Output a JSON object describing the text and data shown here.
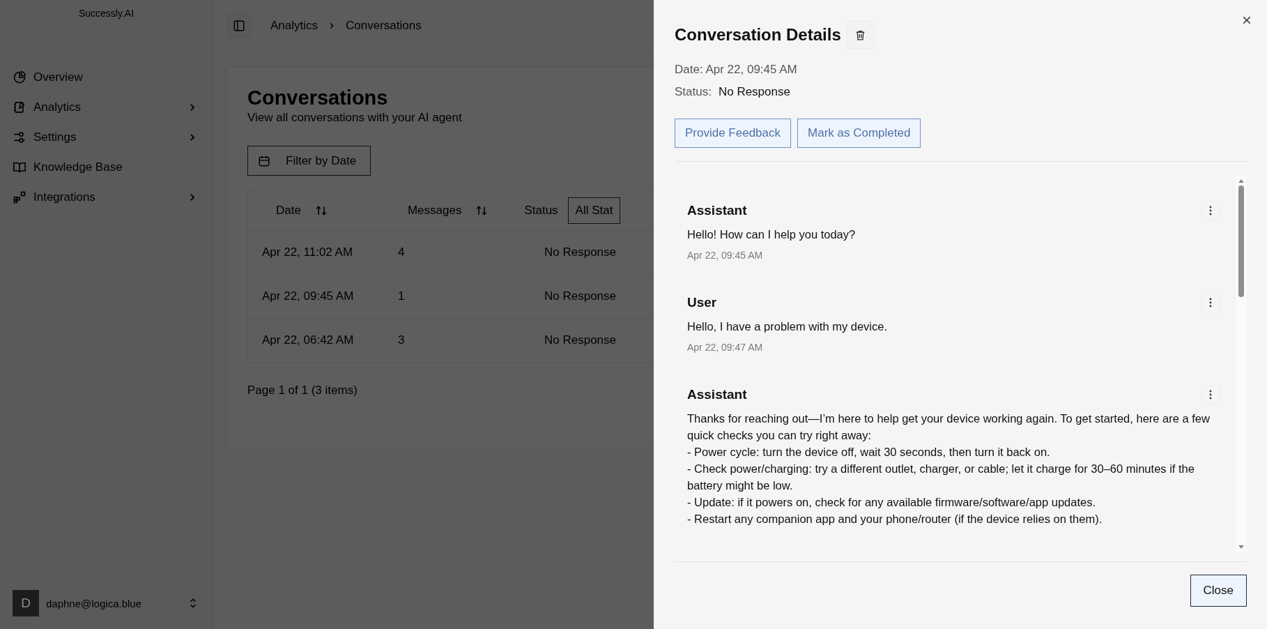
{
  "sidebar": {
    "logo": "Successly.AI",
    "items": [
      {
        "label": "Overview",
        "has_submenu": false
      },
      {
        "label": "Analytics",
        "has_submenu": true
      },
      {
        "label": "Settings",
        "has_submenu": true
      },
      {
        "label": "Knowledge Base",
        "has_submenu": false
      },
      {
        "label": "Integrations",
        "has_submenu": true
      }
    ],
    "user": {
      "initial": "D",
      "email": "daphne@logica.blue"
    }
  },
  "breadcrumb": [
    "Analytics",
    "Conversations"
  ],
  "page": {
    "title": "Conversations",
    "subtitle": "View all conversations with your AI agent",
    "filter_button": "Filter by Date",
    "table": {
      "columns": [
        {
          "label": "Date",
          "sortable": true
        },
        {
          "label": "Messages",
          "sortable": true
        },
        {
          "label": "Status",
          "sortable": false
        }
      ],
      "status_filter": "All Stat",
      "rows": [
        [
          "Apr 22, 11:02 AM",
          "4",
          "No Response"
        ],
        [
          "Apr 22, 09:45 AM",
          "1",
          "No Response"
        ],
        [
          "Apr 22, 06:42 AM",
          "3",
          "No Response"
        ]
      ]
    },
    "pager": "Page 1 of 1 (3 items)"
  },
  "panel": {
    "title": "Conversation Details",
    "date": "Date: Apr 22, 09:45 AM",
    "status_label": "Status:",
    "status": "No Response",
    "actions": [
      "Provide Feedback",
      "Mark as Completed"
    ],
    "messages": [
      {
        "sender": "Assistant",
        "text": "Hello! How can I help you today?",
        "time": "Apr 22, 09:45 AM"
      },
      {
        "sender": "User",
        "text": "Hello, I have a problem with my device.",
        "time": "Apr 22, 09:47 AM"
      },
      {
        "sender": "Assistant",
        "text": "Thanks for reaching out—I’m here to help get your device working again. To get started, here are a few quick checks you can try right away:\n- Power cycle: turn the device off, wait 30 seconds, then turn it back on.\n- Check power/charging: try a different outlet, charger, or cable; let it charge for 30–60 minutes if the battery might be low.\n- Update: if it powers on, check for any available firmware/software/app updates.\n- Restart any companion app and your phone/router (if the device relies on them)."
      }
    ],
    "close_button": "Close"
  }
}
